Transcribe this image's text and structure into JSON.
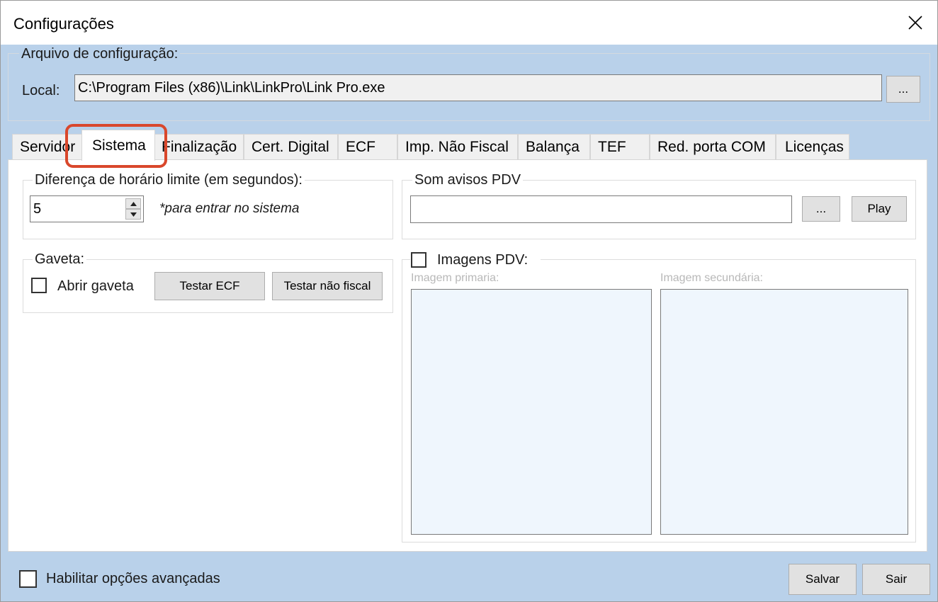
{
  "window": {
    "title": "Configurações"
  },
  "config_file": {
    "group_title": "Arquivo de configuração:",
    "local_label": "Local:",
    "path": "C:\\Program Files (x86)\\Link\\LinkPro\\Link Pro.exe",
    "browse_label": "..."
  },
  "tabs": [
    {
      "label": "Servidor"
    },
    {
      "label": "Sistema"
    },
    {
      "label": "Finalização"
    },
    {
      "label": "Cert. Digital"
    },
    {
      "label": "ECF"
    },
    {
      "label": "Imp. Não Fiscal"
    },
    {
      "label": "Balança"
    },
    {
      "label": "TEF"
    },
    {
      "label": "Red. porta COM"
    },
    {
      "label": "Licenças"
    }
  ],
  "active_tab": "Sistema",
  "sistema": {
    "time_diff": {
      "title": "Diferença de horário limite (em segundos):",
      "value": "5",
      "hint": "*para entrar no sistema"
    },
    "sound": {
      "title": "Som avisos PDV",
      "path": "",
      "browse_label": "...",
      "play_label": "Play"
    },
    "drawer": {
      "title": "Gaveta:",
      "open_label": "Abrir gaveta",
      "open_checked": false,
      "test_ecf_label": "Testar ECF",
      "test_nonfiscal_label": "Testar não fiscal"
    },
    "images": {
      "title": "Imagens PDV:",
      "checked": false,
      "primary_label": "Imagem primaria:",
      "secondary_label": "Imagem secundária:"
    }
  },
  "footer": {
    "advanced_label": "Habilitar opções avançadas",
    "advanced_checked": false,
    "save_label": "Salvar",
    "exit_label": "Sair"
  },
  "colors": {
    "window_bg": "#b9d1ea",
    "highlight": "#d9472b",
    "image_box": "#eff6fd"
  }
}
